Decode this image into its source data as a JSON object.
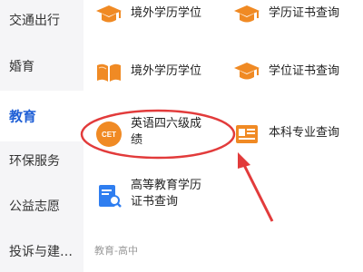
{
  "sidebar": {
    "items": [
      {
        "label": "交通出行",
        "active": false
      },
      {
        "label": "婚育",
        "active": false
      },
      {
        "label": "教育",
        "active": true
      },
      {
        "label": "环保服务",
        "active": false
      },
      {
        "label": "公益志愿",
        "active": false
      },
      {
        "label": "投诉与建…",
        "active": false
      }
    ]
  },
  "services": [
    {
      "label": "境外学历学位",
      "icon": "graduation-cap-icon"
    },
    {
      "label": "学历证书查询",
      "icon": "graduation-cap-icon"
    },
    {
      "label": "境外学历学位",
      "icon": "book-icon"
    },
    {
      "label": "学位证书查询",
      "icon": "graduation-cap-icon"
    },
    {
      "label_line1": "英语四六级成",
      "label_line2": "绩",
      "icon": "cet-badge-icon",
      "icon_text": "CET"
    },
    {
      "label": "本科专业查询",
      "icon": "id-card-icon"
    },
    {
      "label_line1": "高等教育学历",
      "label_line2": "证书查询",
      "icon": "document-search-icon"
    }
  ],
  "section_label": "教育-高中",
  "annotation": {
    "color": "#e23b3b"
  },
  "colors": {
    "accent": "#1f5fd6",
    "icon_orange": "#f08a24",
    "icon_blue": "#2f7ef0"
  }
}
